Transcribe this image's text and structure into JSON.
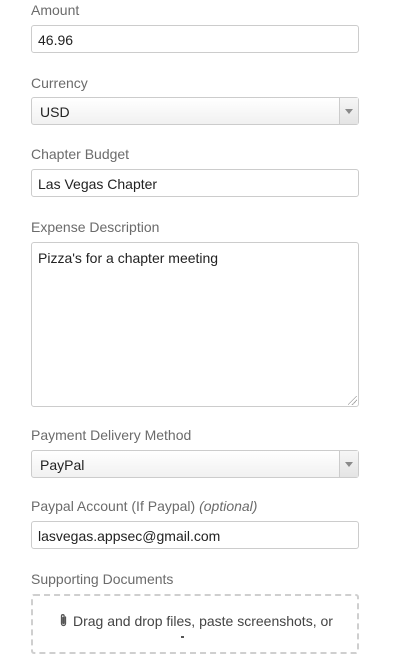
{
  "amount": {
    "label": "Amount",
    "value": "46.96"
  },
  "currency": {
    "label": "Currency",
    "value": "USD"
  },
  "chapter_budget": {
    "label": "Chapter Budget",
    "value": "Las Vegas Chapter"
  },
  "expense_description": {
    "label": "Expense Description",
    "value": "Pizza's for a chapter meeting"
  },
  "payment_delivery_method": {
    "label": "Payment Delivery Method",
    "value": "PayPal"
  },
  "paypal_account": {
    "label": "Paypal Account (If Paypal)",
    "optional_note": "(optional)",
    "value": "lasvegas.appsec@gmail.com"
  },
  "supporting_documents": {
    "label": "Supporting Documents",
    "dropzone_text": "Drag and drop files, paste screenshots, or",
    "icon": "paperclip-icon"
  }
}
